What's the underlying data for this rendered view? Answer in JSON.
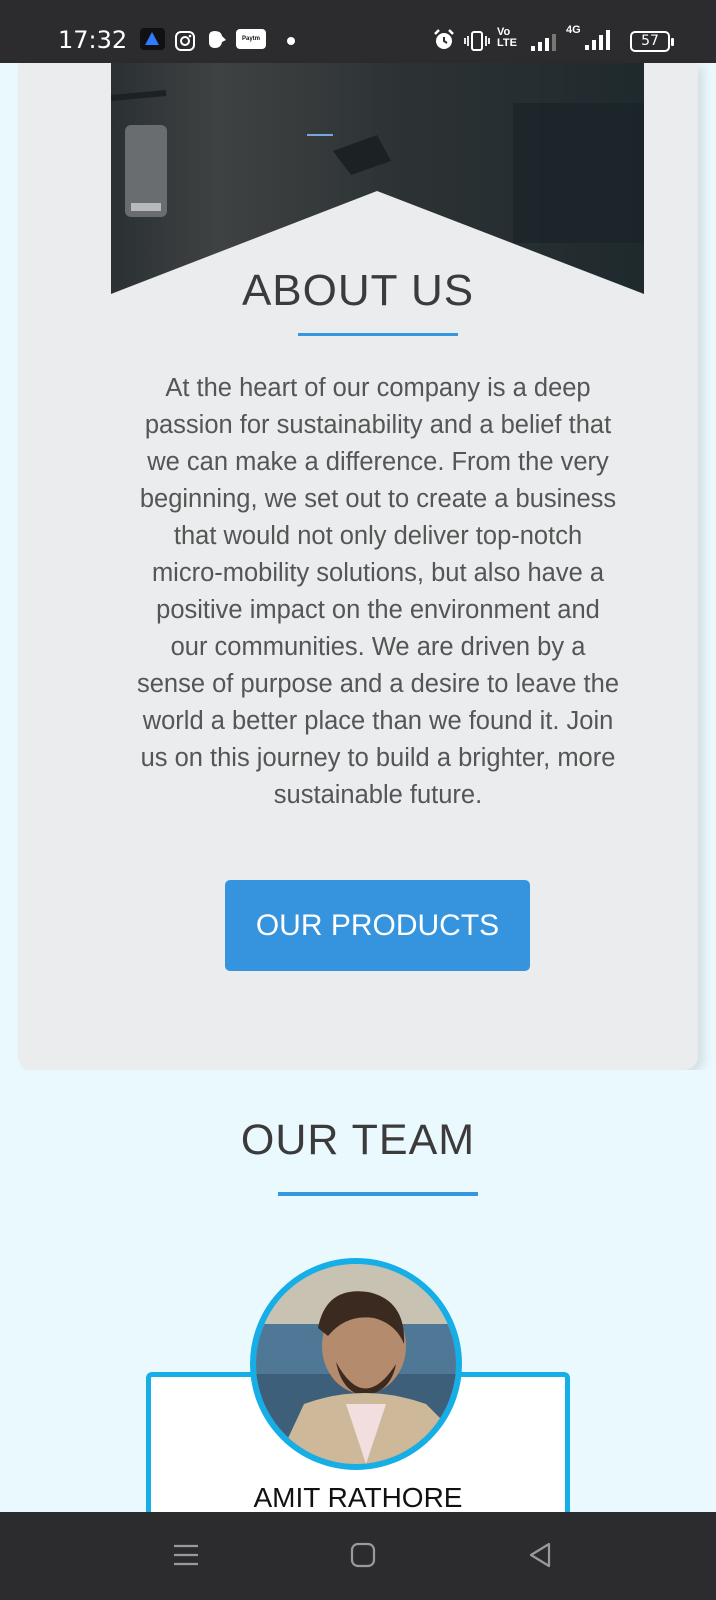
{
  "status_bar": {
    "time": "17:32",
    "network_label_top": "Vo",
    "network_label_bottom": "LTE",
    "mobile_data": "4G",
    "battery": "57",
    "icons": [
      "app-icon",
      "instagram-icon",
      "notification-icon",
      "paytm-icon",
      "dot-icon",
      "alarm-icon",
      "vibrate-icon",
      "volte-icon",
      "signal-icon",
      "signal-4g-icon",
      "battery-icon"
    ]
  },
  "about": {
    "title": "ABOUT US",
    "body": "At the heart of our company is a deep passion for sustainability and a belief that we can make a difference. From the very beginning, we set out to create a business that would not only deliver top-notch micro-mobility solutions, but also have a positive impact on the environment and our communities. We are driven by a sense of purpose and a desire to leave the world a better place than we found it. Join us on this journey to build a brighter, more sustainable future.",
    "button_label": "OUR PRODUCTS"
  },
  "team": {
    "title": "OUR TEAM",
    "members": [
      {
        "name": "AMIT RATHORE"
      }
    ]
  },
  "nav": {
    "items": [
      "recent-apps-icon",
      "home-icon",
      "back-icon"
    ]
  },
  "colors": {
    "accent": "#3594dd",
    "avatar_ring": "#15aee6",
    "card_bg": "#eaeced",
    "team_bg": "#eaf9fd",
    "system_bar": "#2c2c2e"
  }
}
